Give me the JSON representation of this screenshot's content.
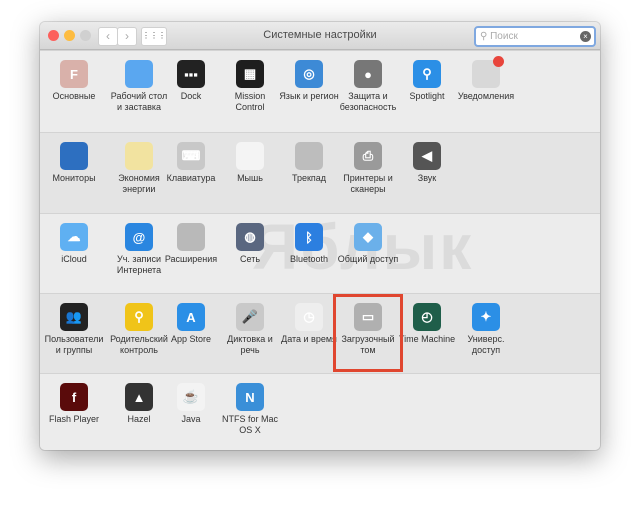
{
  "window": {
    "title": "Системные настройки",
    "search_placeholder": "Поиск",
    "back": "‹",
    "forward": "›",
    "grid": "⋮⋮⋮"
  },
  "watermark": "Яблык",
  "highlight_color": "#e0462f",
  "sections": [
    [
      {
        "label": "Основные",
        "icon": "general-icon",
        "color": "#d9b1aa",
        "glyph": "F"
      },
      {
        "label": "Рабочий стол и заставка",
        "icon": "desktop-icon",
        "color": "#5aa7f0",
        "glyph": ""
      },
      {
        "label": "Dock",
        "icon": "dock-icon",
        "color": "#222",
        "glyph": "▪▪▪"
      },
      {
        "label": "Mission Control",
        "icon": "mission-control-icon",
        "color": "#1e1e1e",
        "glyph": "▦"
      },
      {
        "label": "Язык и регион",
        "icon": "flag-icon",
        "color": "#3d8ad6",
        "glyph": "◎"
      },
      {
        "label": "Защита и безопасность",
        "icon": "house-lock-icon",
        "color": "#777",
        "glyph": "●"
      },
      {
        "label": "Spotlight",
        "icon": "spotlight-icon",
        "color": "#2b8fe6",
        "glyph": "⚲"
      },
      {
        "label": "Уведомления",
        "icon": "notifications-icon",
        "color": "#d8d8d8",
        "glyph": ""
      }
    ],
    [
      {
        "label": "Мониторы",
        "icon": "monitor-icon",
        "color": "#2d6fc0",
        "glyph": ""
      },
      {
        "label": "Экономия энергии",
        "icon": "bulb-icon",
        "color": "#f2e3a0",
        "glyph": ""
      },
      {
        "label": "Клавиатура",
        "icon": "keyboard-icon",
        "color": "#c8c8c8",
        "glyph": "⌨"
      },
      {
        "label": "Мышь",
        "icon": "mouse-icon",
        "color": "#f4f4f4",
        "glyph": ""
      },
      {
        "label": "Трекпад",
        "icon": "trackpad-icon",
        "color": "#bdbdbd",
        "glyph": ""
      },
      {
        "label": "Принтеры и сканеры",
        "icon": "printer-icon",
        "color": "#9a9a9a",
        "glyph": "⎙"
      },
      {
        "label": "Звук",
        "icon": "speaker-icon",
        "color": "#555",
        "glyph": "◀"
      }
    ],
    [
      {
        "label": "iCloud",
        "icon": "cloud-icon",
        "color": "#5fb0f2",
        "glyph": "☁"
      },
      {
        "label": "Уч. записи Интернета",
        "icon": "at-icon",
        "color": "#2a86e0",
        "glyph": "@"
      },
      {
        "label": "Расширения",
        "icon": "puzzle-icon",
        "color": "#b9b9b9",
        "glyph": ""
      },
      {
        "label": "Сеть",
        "icon": "globe-icon",
        "color": "#5a6780",
        "glyph": "◍"
      },
      {
        "label": "Bluetooth",
        "icon": "bluetooth-icon",
        "color": "#2c7fe0",
        "glyph": "ᛒ"
      },
      {
        "label": "Общий доступ",
        "icon": "folder-share-icon",
        "color": "#6bb0ea",
        "glyph": "◆"
      }
    ],
    [
      {
        "label": "Пользователи и группы",
        "icon": "users-icon",
        "color": "#222",
        "glyph": "👥"
      },
      {
        "label": "Родительский контроль",
        "icon": "parental-icon",
        "color": "#f0c419",
        "glyph": "⚲"
      },
      {
        "label": "App Store",
        "icon": "appstore-icon",
        "color": "#2b8fe6",
        "glyph": "A"
      },
      {
        "label": "Диктовка и речь",
        "icon": "microphone-icon",
        "color": "#c9c9c9",
        "glyph": "🎤"
      },
      {
        "label": "Дата и время",
        "icon": "clock-icon",
        "color": "#eee",
        "glyph": "◷"
      },
      {
        "label": "Загрузочный том",
        "icon": "disk-icon",
        "color": "#b0b0b0",
        "glyph": "▭"
      },
      {
        "label": "Time Machine",
        "icon": "time-machine-icon",
        "color": "#1f5e4a",
        "glyph": "◴"
      },
      {
        "label": "Универс. доступ",
        "icon": "accessibility-icon",
        "color": "#2b8fe6",
        "glyph": "✦"
      }
    ],
    [
      {
        "label": "Flash Player",
        "icon": "flash-icon",
        "color": "#5a0b0b",
        "glyph": "f"
      },
      {
        "label": "Hazel",
        "icon": "hazel-icon",
        "color": "#333",
        "glyph": "▲"
      },
      {
        "label": "Java",
        "icon": "java-icon",
        "color": "#f3f3f3",
        "glyph": "☕"
      },
      {
        "label": "NTFS for Mac OS X",
        "icon": "ntfs-icon",
        "color": "#3a8fd8",
        "glyph": "N"
      }
    ]
  ]
}
